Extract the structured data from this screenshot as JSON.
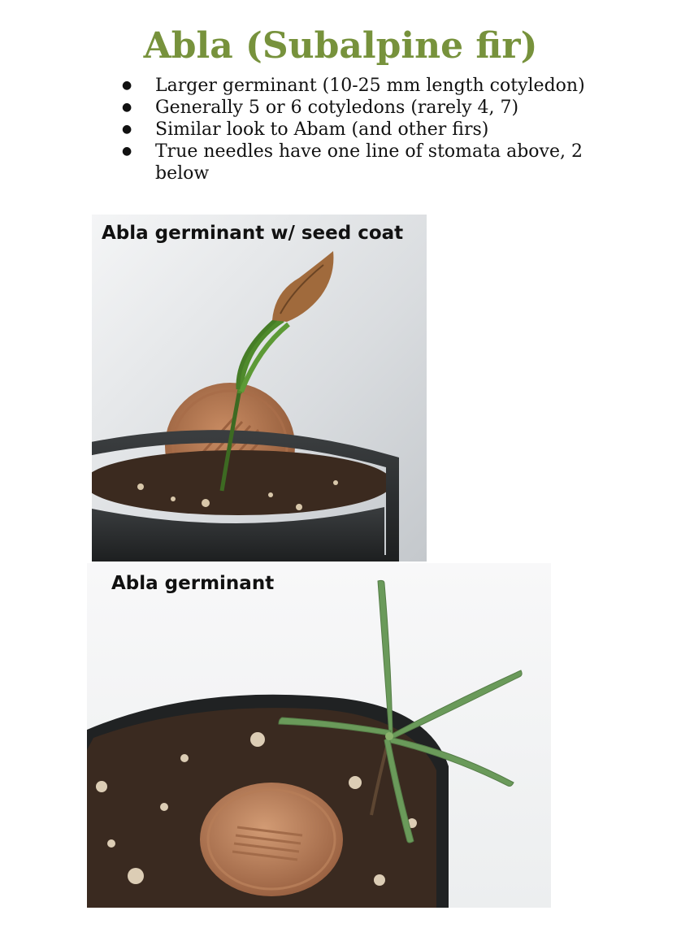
{
  "title": "Abla (Subalpine fir)",
  "bullets": [
    "Larger germinant (10-25 mm length cotyledon)",
    "Generally 5 or 6 cotyledons (rarely 4, 7)",
    "Similar look to Abam (and other firs)",
    "True needles have one line of stomata above, 2 below"
  ],
  "photos": [
    {
      "caption": "Abla germinant w/ seed coat"
    },
    {
      "caption": "Abla germinant"
    }
  ],
  "colors": {
    "title": "#77923c"
  }
}
